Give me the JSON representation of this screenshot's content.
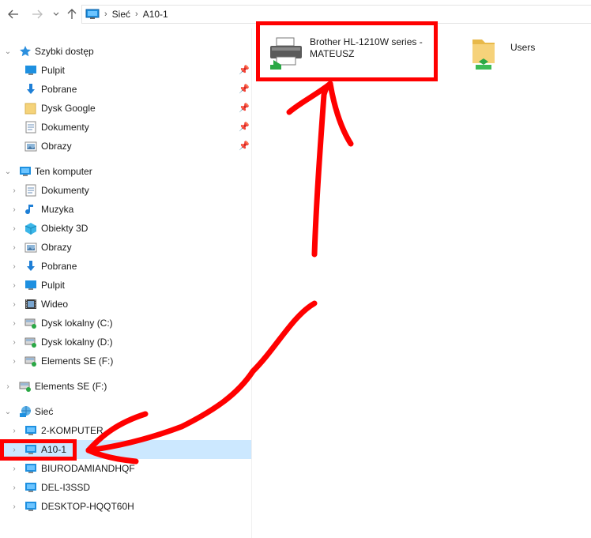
{
  "address": {
    "crumbs": [
      "Sieć",
      "A10-1"
    ]
  },
  "nav": {
    "quick_access": {
      "label": "Szybki dostęp",
      "items": [
        {
          "label": "Pulpit",
          "icon": "desktop-icon"
        },
        {
          "label": "Pobrane",
          "icon": "download-icon"
        },
        {
          "label": "Dysk Google",
          "icon": "folder-icon"
        },
        {
          "label": "Dokumenty",
          "icon": "documents-icon"
        },
        {
          "label": "Obrazy",
          "icon": "pictures-icon"
        }
      ]
    },
    "this_pc": {
      "label": "Ten komputer",
      "items": [
        {
          "label": "Dokumenty",
          "icon": "documents-icon"
        },
        {
          "label": "Muzyka",
          "icon": "music-icon"
        },
        {
          "label": "Obiekty 3D",
          "icon": "3d-objects-icon"
        },
        {
          "label": "Obrazy",
          "icon": "pictures-icon"
        },
        {
          "label": "Pobrane",
          "icon": "download-icon"
        },
        {
          "label": "Pulpit",
          "icon": "desktop-icon"
        },
        {
          "label": "Wideo",
          "icon": "video-icon"
        },
        {
          "label": "Dysk lokalny (C:)",
          "icon": "drive-icon"
        },
        {
          "label": "Dysk lokalny (D:)",
          "icon": "drive-icon"
        },
        {
          "label": "Elements SE (F:)",
          "icon": "drive-icon"
        }
      ]
    },
    "elements_root": {
      "label": "Elements SE (F:)"
    },
    "network": {
      "label": "Sieć",
      "items": [
        {
          "label": "2-KOMPUTER"
        },
        {
          "label": "A10-1"
        },
        {
          "label": "BIURODAMIANDHQF"
        },
        {
          "label": "DEL-I3SSD"
        },
        {
          "label": "DESKTOP-HQQT60H"
        }
      ]
    }
  },
  "content": {
    "items": [
      {
        "name": "Brother HL-1210W series - MATEUSZ",
        "line1": "Brother HL-1210W series -",
        "line2": "MATEUSZ",
        "icon": "printer-icon"
      },
      {
        "name": "Users",
        "icon": "shared-folder-icon"
      }
    ]
  },
  "colors": {
    "selection": "#cce8ff",
    "annotation": "#ff0000",
    "accent": "#0078d7"
  }
}
